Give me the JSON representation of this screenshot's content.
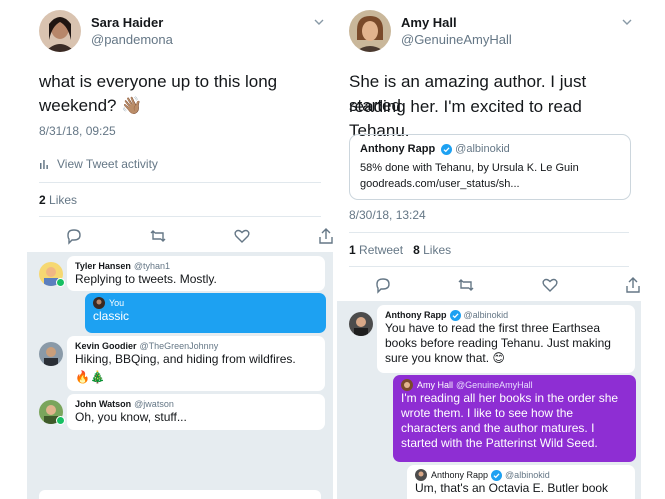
{
  "left": {
    "author": {
      "name": "Sara Haider",
      "handle": "@pandemona"
    },
    "text_line1": "what is everyone up to this long",
    "text_line2": "weekend? 👋🏽",
    "timestamp": "8/31/18, 09:25",
    "activity_label": "View Tweet activity",
    "likes_count": "2",
    "likes_label": "Likes",
    "replies": [
      {
        "name": "Tyler Hansen",
        "handle": "@tyhan1",
        "text": "Replying to tweets. Mostly."
      },
      {
        "name": "You",
        "text": "classic"
      },
      {
        "name": "Kevin Goodier",
        "handle": "@TheGreenJohnny",
        "text": "Hiking, BBQing, and hiding from wildfires.",
        "emoji": "🔥🎄"
      },
      {
        "name": "John Watson",
        "handle": "@jwatson",
        "text": "Oh, you know, stuff..."
      }
    ]
  },
  "right": {
    "author": {
      "name": "Amy Hall",
      "handle": "@GenuineAmyHall"
    },
    "text_line1": "She is an amazing author. I just started",
    "text_line2": "reading her.  I'm excited to read Tehanu.",
    "quote": {
      "name": "Anthony Rapp",
      "handle": "@albinokid",
      "line1": "58% done with Tehanu, by Ursula K. Le Guin",
      "line2": "goodreads.com/user_status/sh..."
    },
    "timestamp": "8/30/18, 13:24",
    "retweets_count": "1",
    "retweets_label": "Retweet",
    "likes_count": "8",
    "likes_label": "Likes",
    "replies": [
      {
        "name": "Anthony Rapp",
        "handle": "@albinokid",
        "line1": "You have to read the first three Earthsea",
        "line2": "books before reading Tehanu. Just making",
        "line3": "sure you know that. 😊"
      },
      {
        "name": "Amy Hall",
        "handle": "@GenuineAmyHall",
        "line1": "I'm reading all her books in the order she",
        "line2": "wrote them.  I like to see how the",
        "line3": "characters and the author matures.  I",
        "line4": "started with the Patterinst Wild Seed."
      },
      {
        "name": "Anthony Rapp",
        "handle": "@albinokid",
        "line1": "Um, that's an Octavia E. Butler book"
      }
    ]
  },
  "colors": {
    "accent": "#1da1f2",
    "purple": "#8e2ed3",
    "convo_bg": "#e6ecf0",
    "online": "#17bf63"
  },
  "icons": [
    "chevron-down-icon",
    "reply-icon",
    "retweet-icon",
    "like-icon",
    "share-icon",
    "bar-chart-icon",
    "verified-icon"
  ]
}
